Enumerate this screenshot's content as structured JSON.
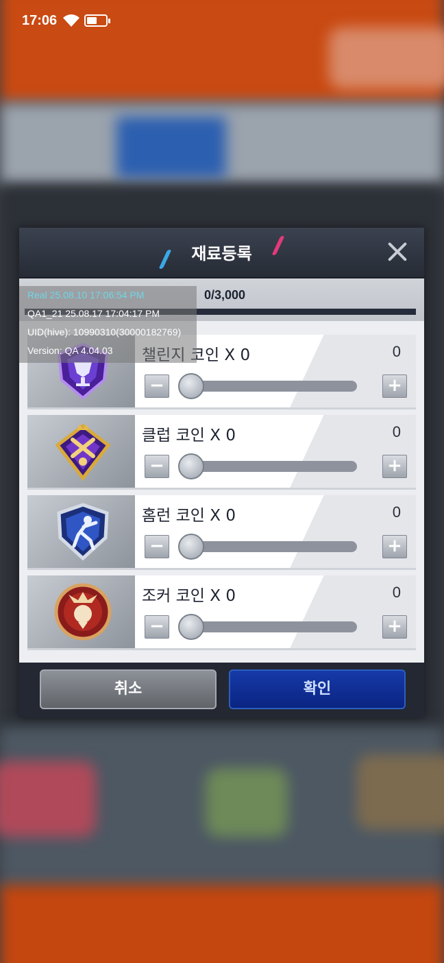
{
  "status_bar": {
    "time": "17:06",
    "battery_level": 0.55
  },
  "dialog": {
    "title": "재료등록",
    "progress": {
      "text": "0/3,000",
      "fraction": 0
    },
    "items": [
      {
        "label": "챌린지 코인 X 0",
        "count": "0",
        "slider_fraction": 0,
        "badge": "challenge-coin-icon"
      },
      {
        "label": "클럽 코인 X 0",
        "count": "0",
        "slider_fraction": 0,
        "badge": "club-coin-icon"
      },
      {
        "label": "홈런 코인 X 0",
        "count": "0",
        "slider_fraction": 0,
        "badge": "homerun-coin-icon"
      },
      {
        "label": "조커 코인 X 0",
        "count": "0",
        "slider_fraction": 0,
        "badge": "joker-coin-icon"
      }
    ],
    "cancel_label": "취소",
    "confirm_label": "확인"
  },
  "debug": {
    "real": "Real    25.08.10 17:06:54 PM",
    "qa": "QA1_21  25.08.17 17:04:17 PM",
    "uid": "UID(hive): 10990310(30000182769)",
    "version": "Version: QA 4.04.03"
  }
}
